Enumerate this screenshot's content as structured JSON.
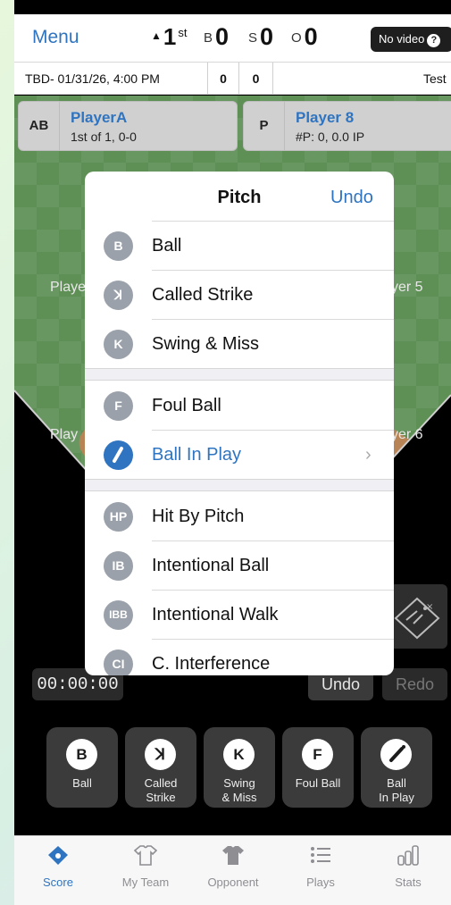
{
  "header": {
    "menu_label": "Menu",
    "inning_arrow": "▲",
    "inning_number": "1",
    "inning_suffix": "st",
    "balls_label": "B",
    "balls": "0",
    "strikes_label": "S",
    "strikes": "0",
    "outs_label": "O",
    "outs": "0",
    "video_label": "No video",
    "video_help": "?"
  },
  "game_info": {
    "date": "TBD- 01/31/26, 4:00 PM",
    "score_a": "0",
    "score_b": "0",
    "team": "Test"
  },
  "batter": {
    "tag": "AB",
    "name": "PlayerA",
    "line": "1st of 1, 0-0"
  },
  "pitcher": {
    "tag": "P",
    "name": "Player 8",
    "line": "#P: 0, 0.0 IP"
  },
  "field_positions": {
    "left_upper": "Playe",
    "right_upper": "yer 5",
    "left_lower": "Play",
    "right_lower": "yer 6"
  },
  "pitch_menu": {
    "title": "Pitch",
    "undo_label": "Undo",
    "groups": [
      [
        {
          "badge": "B",
          "label": "Ball"
        },
        {
          "badge": "ꓘ",
          "label": "Called Strike"
        },
        {
          "badge": "K",
          "label": "Swing & Miss"
        }
      ],
      [
        {
          "badge": "F",
          "label": "Foul Ball"
        },
        {
          "badge": "\\",
          "label": "Ball In Play",
          "chevron": "›"
        }
      ],
      [
        {
          "badge": "HP",
          "label": "Hit By Pitch"
        },
        {
          "badge": "IB",
          "label": "Intentional Ball"
        },
        {
          "badge": "IBB",
          "label": "Intentional Walk"
        },
        {
          "badge": "CI",
          "label": "C. Interference"
        }
      ]
    ]
  },
  "controls": {
    "timer": "00:00:00",
    "undo_label": "Undo",
    "redo_label": "Redo"
  },
  "quick_buttons": [
    {
      "icon": "B",
      "label_1": "Ball",
      "label_2": ""
    },
    {
      "icon": "ꓘ",
      "label_1": "Called",
      "label_2": "Strike"
    },
    {
      "icon": "K",
      "label_1": "Swing",
      "label_2": "& Miss"
    },
    {
      "icon": "F",
      "label_1": "Foul Ball",
      "label_2": ""
    },
    {
      "icon": "bat-icon",
      "label_1": "Ball",
      "label_2": "In Play"
    }
  ],
  "tabs": [
    {
      "label": "Score",
      "icon": "baseball-diamond-icon",
      "active": true
    },
    {
      "label": "My Team",
      "icon": "jersey-outline-icon",
      "active": false
    },
    {
      "label": "Opponent",
      "icon": "jersey-filled-icon",
      "active": false
    },
    {
      "label": "Plays",
      "icon": "list-icon",
      "active": false
    },
    {
      "label": "Stats",
      "icon": "bar-chart-icon",
      "active": false
    }
  ],
  "colors": {
    "accent": "#2f74c0",
    "badge_gray": "#9aa1aa",
    "grass": "#5e8f55"
  }
}
